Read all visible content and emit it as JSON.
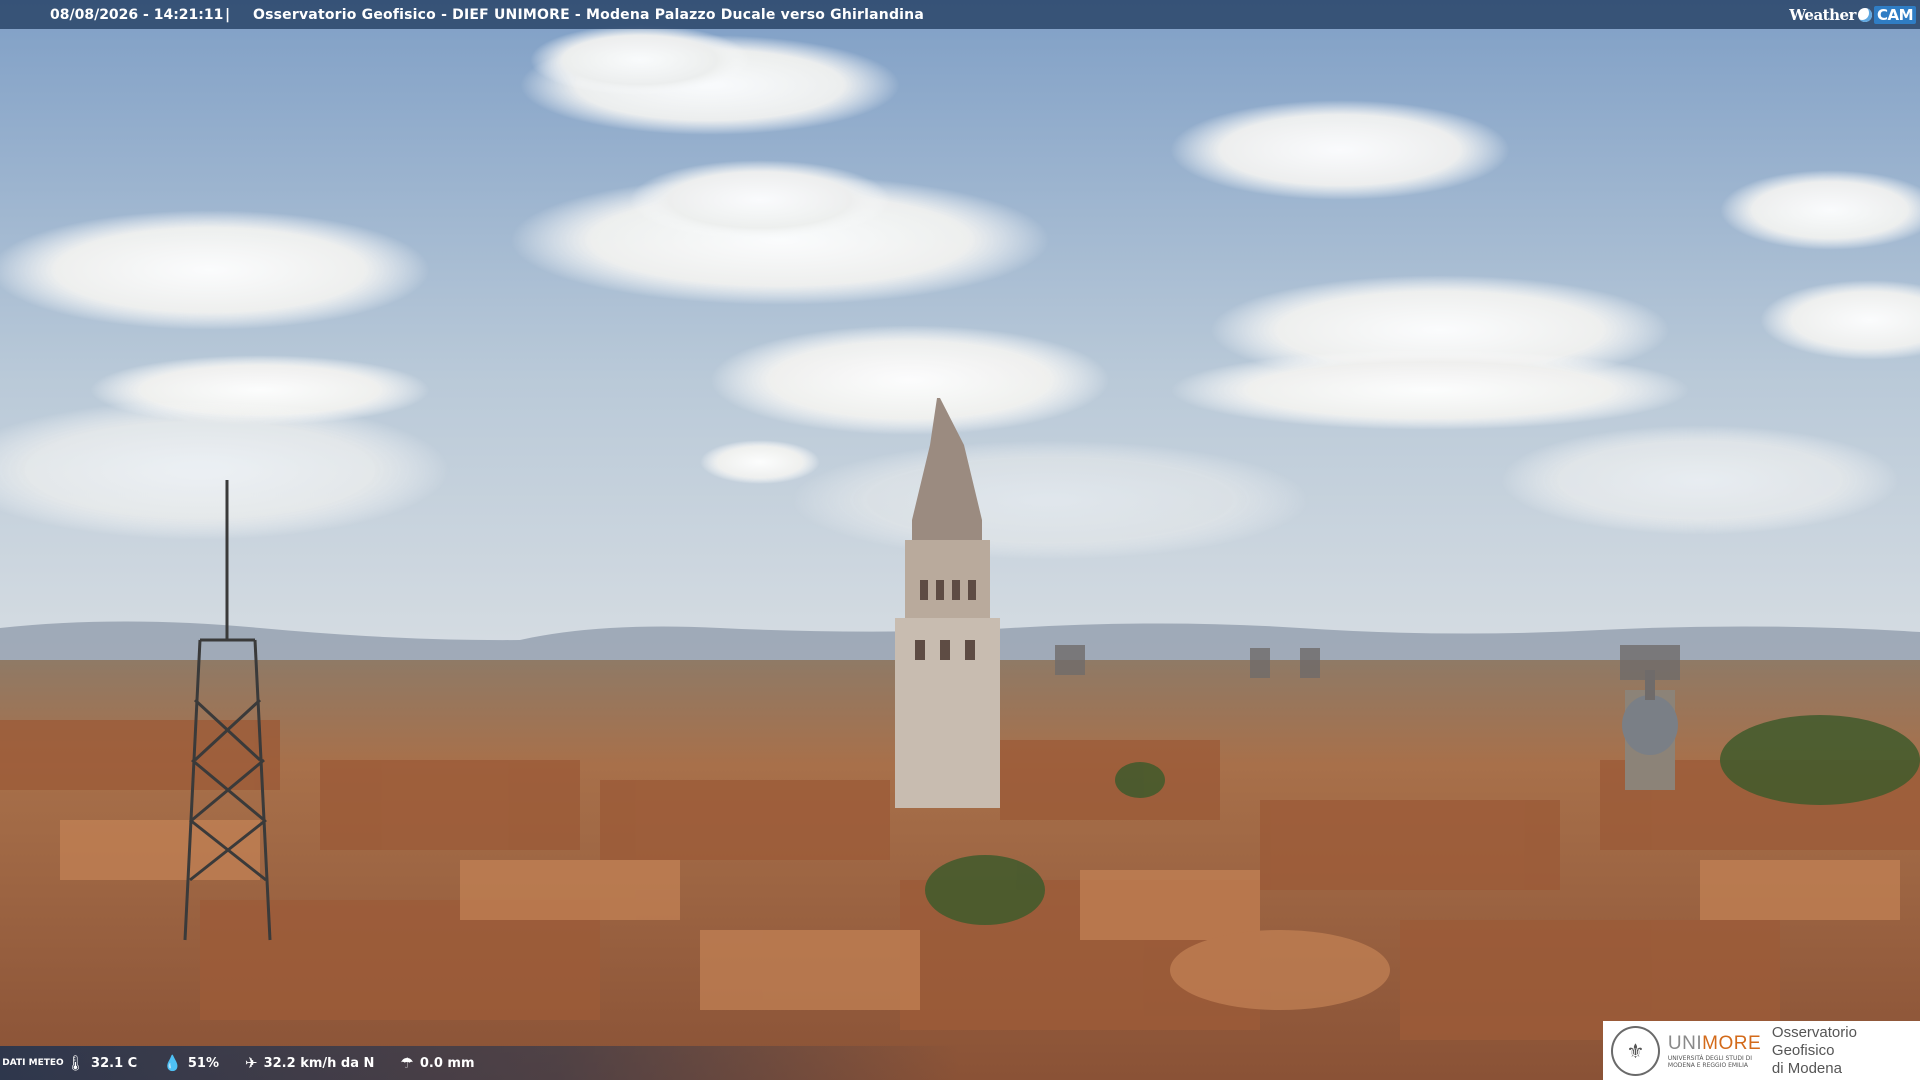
{
  "header": {
    "timestamp": "08/08/2026 - 14:21:11",
    "separator": "|",
    "camera_title": "Osservatorio Geofisico - DIEF UNIMORE - Modena Palazzo Ducale verso Ghirlandina",
    "brand_weather": "Weather",
    "brand_cam": "CAM"
  },
  "weather": {
    "label": "DATI METEO",
    "temperature": "32.1 C",
    "humidity": "51%",
    "wind": "32.2 km/h da N",
    "rain": "0.0 mm"
  },
  "logo": {
    "uni_prefix": "UNI",
    "uni_suffix": "MORE",
    "uni_sub": "UNIVERSITÀ DEGLI STUDI DI MODENA E REGGIO EMILIA",
    "observatory_line1": "Osservatorio Geofisico",
    "observatory_line2": "di Modena"
  },
  "scene": {
    "sky_top": "#7f9fc6",
    "sky_horizon": "#d4dde4",
    "roof_color": "#b86f45",
    "icons": [
      "thermometer-icon",
      "humidity-icon",
      "wind-icon",
      "rain-icon",
      "weathercam-logo-icon",
      "unimore-seal-icon"
    ]
  }
}
